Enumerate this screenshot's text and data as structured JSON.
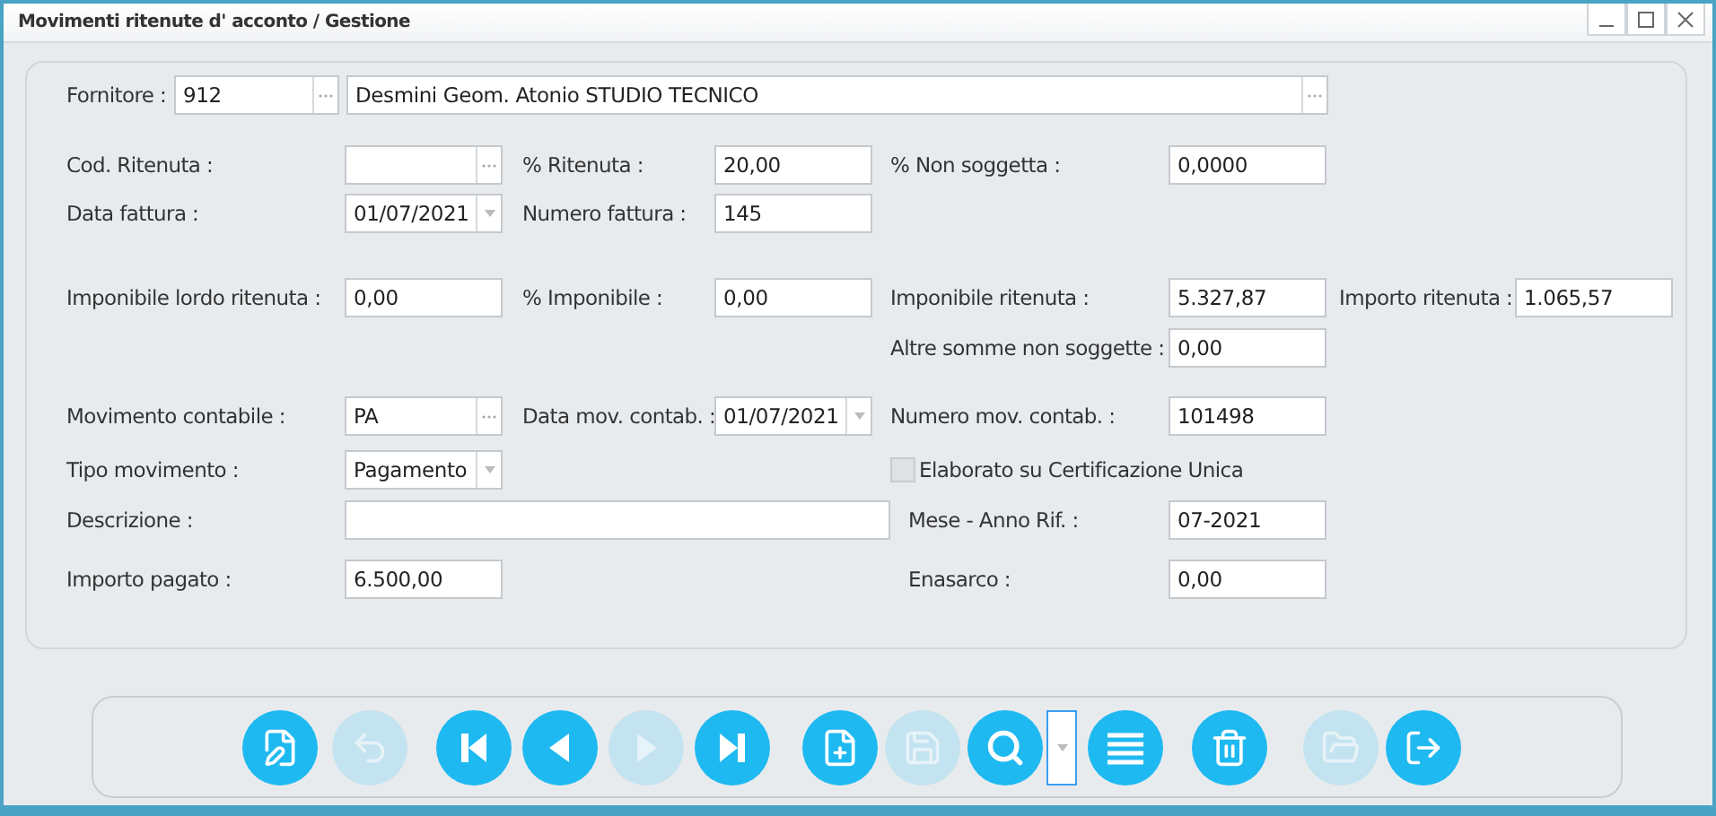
{
  "window": {
    "title": "Movimenti ritenute d' acconto / Gestione"
  },
  "supplier": {
    "label": "Fornitore :",
    "code": "912",
    "name": "Desmini Geom. Atonio STUDIO TECNICO"
  },
  "rows": [
    [
      {
        "kind": "lookup",
        "label": "Cod. Ritenuta :"
      },
      {
        "kind": "text",
        "label": "% Ritenuta :",
        "value": "20,00"
      },
      {
        "kind": "text",
        "label": "% Non soggetta :",
        "value": "0,0000"
      }
    ],
    [
      {
        "kind": "date",
        "label": "Data fattura :",
        "value": "01/07/2021"
      },
      {
        "kind": "text",
        "label": "Numero fattura :",
        "value": "145"
      }
    ],
    [
      {
        "kind": "text",
        "label": "Imponibile lordo ritenuta :",
        "value": "0,00"
      },
      {
        "kind": "text",
        "label": "% Imponibile :",
        "value": "0,00"
      },
      {
        "kind": "text",
        "label": "Imponibile ritenuta :",
        "value": "5.327,87"
      },
      {
        "kind": "text",
        "label": "Importo ritenuta :",
        "value": "1.065,57"
      }
    ],
    [
      {
        "kind": "text",
        "label": "Altre somme non soggette :",
        "value": "0,00"
      }
    ],
    [
      {
        "kind": "lookup",
        "label": "Movimento contabile :",
        "value": "PA"
      },
      {
        "kind": "date",
        "label": "Data mov. contab. :",
        "value": "01/07/2021"
      },
      {
        "kind": "text",
        "label": "Numero mov. contab. :",
        "value": "101498"
      }
    ],
    [
      {
        "kind": "combo",
        "label": "Tipo movimento :",
        "value": "Pagamento"
      },
      {
        "kind": "checkbox",
        "label": "Elaborato su Certificazione Unica",
        "checked": false
      }
    ],
    [
      {
        "kind": "wide",
        "label": "Descrizione :"
      },
      {
        "kind": "text",
        "label": "Mese - Anno Rif. :",
        "value": "07-2021"
      }
    ],
    [
      {
        "kind": "text",
        "label": "Importo pagato :",
        "value": "6.500,00"
      },
      {
        "kind": "text",
        "label": "Enasarco :",
        "value": "0,00"
      }
    ]
  ],
  "toolbar": [
    {
      "kind": "edit",
      "disabled": false
    },
    {
      "kind": "undo",
      "disabled": true
    },
    {
      "kind": "first",
      "disabled": false
    },
    {
      "kind": "previous",
      "disabled": false
    },
    {
      "kind": "next",
      "disabled": true
    },
    {
      "kind": "last",
      "disabled": false
    },
    {
      "kind": "new",
      "disabled": false
    },
    {
      "kind": "save",
      "disabled": true
    },
    {
      "kind": "search",
      "disabled": false
    },
    {
      "kind": "search_options"
    },
    {
      "kind": "list",
      "disabled": false
    },
    {
      "kind": "delete",
      "disabled": false
    },
    {
      "kind": "certificate",
      "disabled": true
    },
    {
      "kind": "exit",
      "disabled": false
    }
  ]
}
